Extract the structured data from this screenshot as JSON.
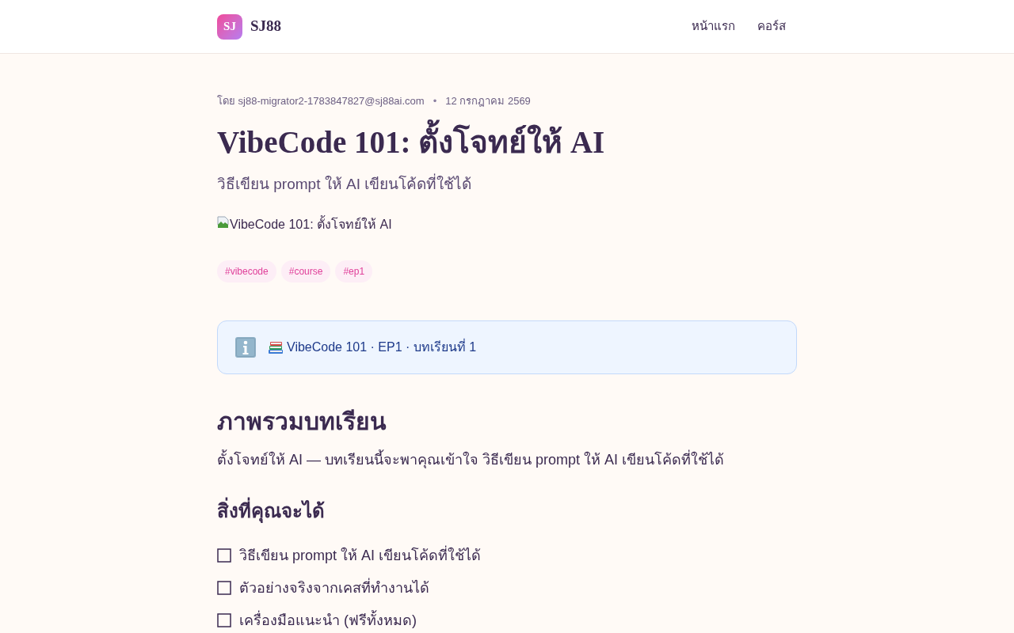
{
  "header": {
    "logo": "SJ",
    "brand": "SJ88",
    "nav": [
      {
        "label": "หน้าแรก"
      },
      {
        "label": "คอร์ส"
      }
    ]
  },
  "article": {
    "author": "โดย sj88-migrator2-1783847827@sj88ai.com",
    "separator": "•",
    "date": "12 กรกฎาคม 2569",
    "title": "VibeCode 101: ตั้งโจทย์ให้ AI",
    "subtitle": "วิธีเขียน prompt ให้ AI เขียนโค้ดที่ใช้ได้",
    "image_alt": "VibeCode 101: ตั้งโจทย์ให้ AI",
    "tags": [
      "#vibecode",
      "#course",
      "#ep1"
    ]
  },
  "callout": {
    "text": "VibeCode 101 · EP1 · บทเรียนที่ 1"
  },
  "content": [
    {
      "kind": "h2",
      "text": "ภาพรวมบทเรียน"
    },
    {
      "kind": "p",
      "text": "ตั้งโจทย์ให้ AI — บทเรียนนี้จะพาคุณเข้าใจ วิธีเขียน prompt ให้ AI เขียนโค้ดที่ใช้ได้"
    },
    {
      "kind": "h3",
      "text": "สิ่งที่คุณจะได้"
    },
    {
      "kind": "checklist",
      "items": [
        {
          "text": "วิธีเขียน prompt ให้ AI เขียนโค้ดที่ใช้ได้",
          "checked": false
        },
        {
          "text": "ตัวอย่างจริงจากเคสที่ทำงานได้",
          "checked": false
        },
        {
          "text": "เครื่องมือแนะนำ (ฟรีทั้งหมด)",
          "checked": false
        }
      ]
    }
  ]
}
